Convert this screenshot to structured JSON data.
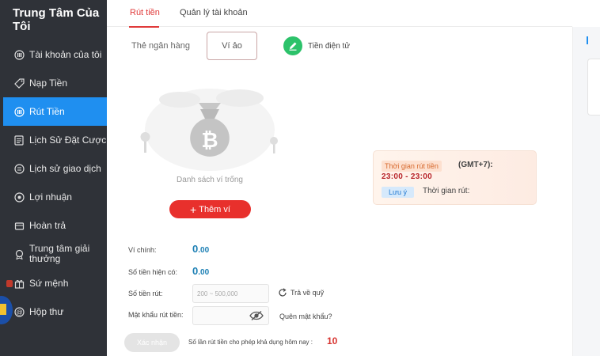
{
  "sidebar": {
    "title": "Trung Tâm Của Tôi",
    "items": [
      {
        "label": "Tài khoản của tôi",
        "icon": "account-icon"
      },
      {
        "label": "Nạp Tiền",
        "icon": "tag-icon"
      },
      {
        "label": "Rút Tiền",
        "icon": "withdraw-icon",
        "active": true
      },
      {
        "label": "Lịch Sử Đặt Cược",
        "icon": "bet-history-icon"
      },
      {
        "label": "Lịch sử giao dịch",
        "icon": "transaction-history-icon"
      },
      {
        "label": "Lợi nhuận",
        "icon": "profit-icon"
      },
      {
        "label": "Hoàn trả",
        "icon": "rebate-icon"
      },
      {
        "label": "Trung tâm giải thưởng",
        "icon": "award-icon"
      },
      {
        "label": "Sứ mệnh",
        "icon": "gift-icon"
      },
      {
        "label": "Hộp thư",
        "icon": "mail-icon"
      }
    ]
  },
  "tabs": [
    {
      "label": "Rút tiền",
      "active": true
    },
    {
      "label": "Quản lý tài khoản",
      "active": false
    }
  ],
  "methods": {
    "bank": "Thẻ ngân hàng",
    "wallet": "Ví ảo",
    "crypto": "Tiền điện tử"
  },
  "empty_state": {
    "text": "Danh sách ví trống",
    "add_button": "Thêm ví"
  },
  "time_info": {
    "badge": "Thời gian rút tiền",
    "timezone": "(GMT+7):",
    "range": "23:00 - 23:00",
    "note_badge": "Lưu ý",
    "note_text": "Thời gian rút:"
  },
  "form": {
    "main_wallet_label": "Ví chính:",
    "main_wallet_value": "0",
    "main_wallet_decimals": ".00",
    "balance_label": "Số tiền hiện có:",
    "balance_value": "0",
    "balance_decimals": ".00",
    "amount_label": "Số tiền rút:",
    "amount_placeholder": "200 ~ 500,000",
    "reset_link": "Trả về quỹ",
    "password_label": "Mật khẩu rút tiền:",
    "forgot_link": "Quên mật khẩu?",
    "confirm_button": "Xác nhận",
    "times_text": "Số lần rút tiền cho phép khả dụng hôm nay :",
    "times_count": "10"
  },
  "colors": {
    "sidebar_bg": "#2f3238",
    "sidebar_active": "#1f8ff0",
    "accent_red": "#e8302c",
    "crypto_green": "#2cc26a",
    "value_blue": "#1b7fb4"
  }
}
